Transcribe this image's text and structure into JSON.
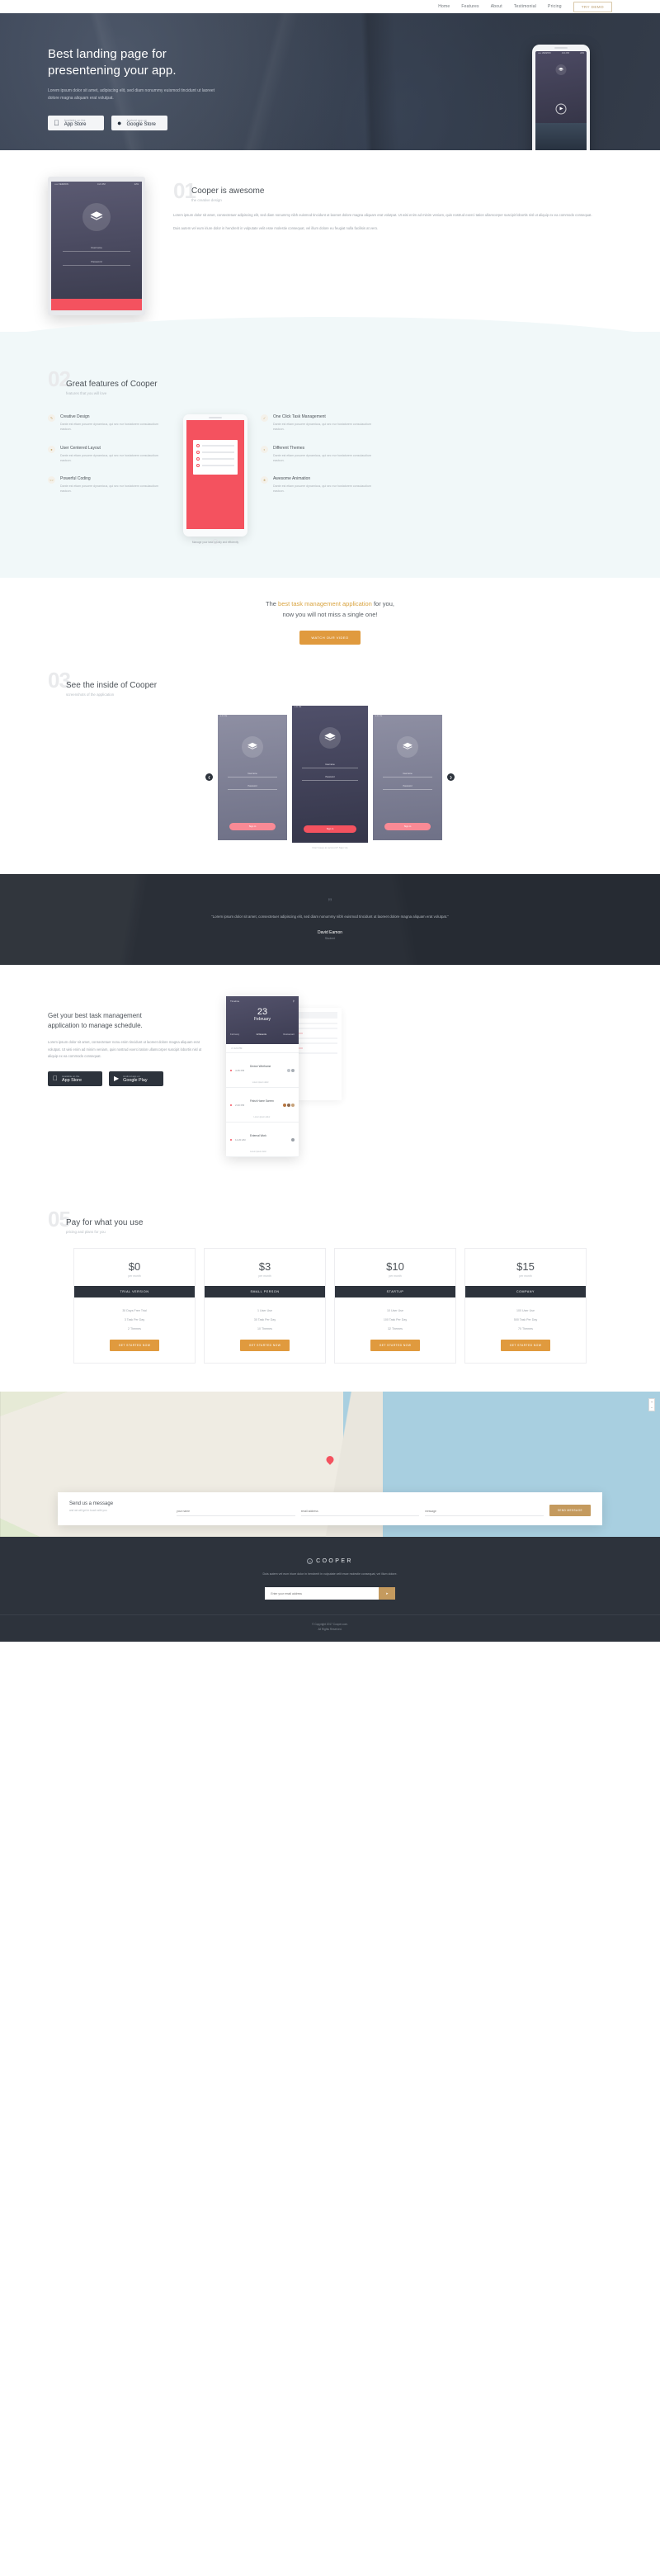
{
  "nav": {
    "items": [
      {
        "label": "Home"
      },
      {
        "label": "Features"
      },
      {
        "label": "About"
      },
      {
        "label": "Testimonial"
      },
      {
        "label": "Pricing"
      }
    ],
    "cta": "TRY DEMO"
  },
  "hero": {
    "title_line1": "Best landing page for",
    "title_line2": "presentening your app.",
    "paragraph": "Lorem ipsum dolor sit amet, adipiscing elit, sed diam nonummy euismod tincidunt ut laoreet dolore magna aliquam erat volutpat.",
    "stores": [
      {
        "icon": "apple-icon",
        "small": "Available on the",
        "big": "App Store",
        "glyph": ""
      },
      {
        "icon": "android-icon",
        "small": "Android app on",
        "big": "Google Store",
        "glyph": "◉"
      }
    ],
    "phone": {
      "carrier": "••••• VERIZON",
      "time": "4:21 PM",
      "battery": "22%",
      "app_name": "COOPER"
    }
  },
  "section01": {
    "number": "01",
    "title": "Cooper is awesome",
    "subtitle": "the creative design",
    "paragraphs": [
      "Lorem ipsum dolor sit amet, consectetuer adipiscing elit, sed diam nonummy nibh euismod tincidunt ut laoreet dolore magna aliquam erat volutpat. Ut wisi enim ad minim veniam, quis nostrud exerci tation ullamcorper suscipit lobortis nisl ut aliquip ex ea commodo consequat.",
      "Duis autem vel eum iriure dolor in hendrerit in vulputate velit esse molestie consequat, vel illum dolore eu feugiat nulla facilisis at vero."
    ],
    "phone": {
      "carrier": "••••• VERIZON",
      "time": "4:21 PM",
      "battery": "22%",
      "field_username": "Username",
      "field_password": "Password",
      "cta": "Sign in"
    }
  },
  "section02": {
    "number": "02",
    "title": "Great features of Cooper",
    "subtitle": "features that you will love",
    "features_left": [
      {
        "icon": "brush-icon",
        "title": "Creative Design",
        "text": "Dante est etiam posuere dynamicus, qui sec eur hostatorem consulaudium eastcon."
      },
      {
        "icon": "user-icon",
        "title": "User Centered Layout",
        "text": "Dante est etiam posuere dynamicus, qui sec eur hostatorem consulaudium eastcon."
      },
      {
        "icon": "code-icon",
        "title": "Powerful Coding",
        "text": "Dante est etiam posuere dynamicus, qui sec eur hostatorem consulaudium eastcon."
      }
    ],
    "features_right": [
      {
        "icon": "click-icon",
        "title": "One Click Task Management",
        "text": "Dante est etiam posuere dynamicus, qui sec eur hostatorem consulaudium eastcon."
      },
      {
        "icon": "palette-icon",
        "title": "Different Themes",
        "text": "Dante est etiam posuere dynamicus, qui sec eur hostatorem consulaudium eastcon."
      },
      {
        "icon": "star-icon",
        "title": "Awesome Animation",
        "text": "Dante est etiam posuere dynamicus, qui sec eur hostatorem consulaudium eastcon."
      }
    ],
    "phone_caption": "Manage your task quickly and efficiently"
  },
  "cta_band": {
    "line1_pre": "The ",
    "line1_highlight": "best task management application",
    "line1_post": " for you,",
    "line2": "now you will not miss a single one!",
    "button": "WATCH OUR VIDEO",
    "highlight_color": "#d9a441"
  },
  "section03": {
    "number": "03",
    "title": "See the inside of Cooper",
    "subtitle": "screenshots of the application",
    "prev_icon": "chevron-left-icon",
    "next_icon": "chevron-right-icon",
    "slides": [
      {
        "username": "Username",
        "password": "Password",
        "cta": "Sign in",
        "time": "4:21 PM"
      },
      {
        "username": "Username",
        "password": "Password",
        "cta": "Sign in",
        "time": "4:21 PM",
        "caption": "Don't keep an account? Sign Up"
      },
      {
        "username": "Username",
        "password": "Password",
        "cta": "Sign in",
        "time": "4:21 PM"
      }
    ]
  },
  "testimonial": {
    "quote_mark": "”",
    "text": "“Lorem ipsum dolor sit amet, consectetuer adipiscing elit, sed diam nonummy nibh euismod tincidunt ut laoreet dolore magna aliquam erat volutpat.”",
    "author": "David Eamon",
    "role": "Student"
  },
  "task_section": {
    "title_line1": "Get your best task management",
    "title_line2": "application to manage schedule.",
    "paragraph": "Lorem ipsum dolor sit amet, consectetuer nonu enim tincidunt ut laoreet dolore magna aliquam erat volutpat. Ut wisi enim ad minim veniam, quis nostrud exerci tation ullamcorper suscipit lobortis nisl ut aliquip ex ea commodo consequat.",
    "stores": [
      {
        "icon": "apple-icon",
        "small": "Available on the",
        "big": "App Store",
        "glyph": ""
      },
      {
        "icon": "android-icon",
        "small": "Android app on",
        "big": "Google Play",
        "glyph": "▶"
      }
    ],
    "card": {
      "header_title": "Timeline",
      "search_icon": "search-icon",
      "day": "23",
      "month": "February",
      "tabs": [
        {
          "label": "February",
          "active": false
        },
        {
          "label": "12 Events",
          "active": true
        },
        {
          "label": "Restaurant",
          "active": false
        }
      ],
      "time_label": "⏱ 4:21 PM",
      "items": [
        {
          "time": "4:45 PM",
          "title": "Device Wireframe",
          "sub": "Lorem ipsum dolor"
        },
        {
          "time": "2:20 PM",
          "title": "Finish Home Screen",
          "sub": "Lorem ipsum dolor"
        },
        {
          "time": "11:20 AM",
          "title": "External Work",
          "sub": "Lorem ipsum dolor"
        }
      ]
    }
  },
  "pricing": {
    "number": "05",
    "title": "Pay for what you use",
    "subtitle": "pricing and plans for you",
    "plans": [
      {
        "price": "$0",
        "per": "per month",
        "tier": "TRIAL VERSION",
        "features": [
          "30 Days Free Trial",
          "3 Task Per Day",
          "2 Themes"
        ],
        "button": "GET STARTED NOW"
      },
      {
        "price": "$3",
        "per": "per month",
        "tier": "SMALL PERSON",
        "features": [
          "1 User Use",
          "30 Task Per Day",
          "10 Themes"
        ],
        "button": "GET STARTED NOW"
      },
      {
        "price": "$10",
        "per": "per month",
        "tier": "STARTUP",
        "features": [
          "10 User Use",
          "100 Task Per Day",
          "32 Themes"
        ],
        "button": "GET STARTED NOW"
      },
      {
        "price": "$15",
        "per": "per month",
        "tier": "COMPANY",
        "features": [
          "100 User Use",
          "500 Task Per Day",
          "70 Themes"
        ],
        "button": "GET STARTED NOW"
      }
    ]
  },
  "map": {
    "pin_icon": "map-pin-icon",
    "zoom_in": "+",
    "zoom_out": "−"
  },
  "contact": {
    "title": "Send us a message",
    "subtitle": "and we will get in touch with you",
    "name_placeholder": "your name",
    "email_placeholder": "email address",
    "message_placeholder": "message",
    "send_button": "SEND MESSAGE"
  },
  "footer": {
    "logo_icon": "cooper-logo-icon",
    "brand": "COOPER",
    "text": "Duis autem vel eum iriure dolor in hendrerit in vulputate velit esse molestie consequat, vel illum dolore.",
    "email_placeholder": "Enter your email address",
    "submit_icon": "arrow-right-icon",
    "copyright_line1": "© Copyright 2017 Cooper.com.",
    "copyright_line2": "All Rights Reserved."
  }
}
